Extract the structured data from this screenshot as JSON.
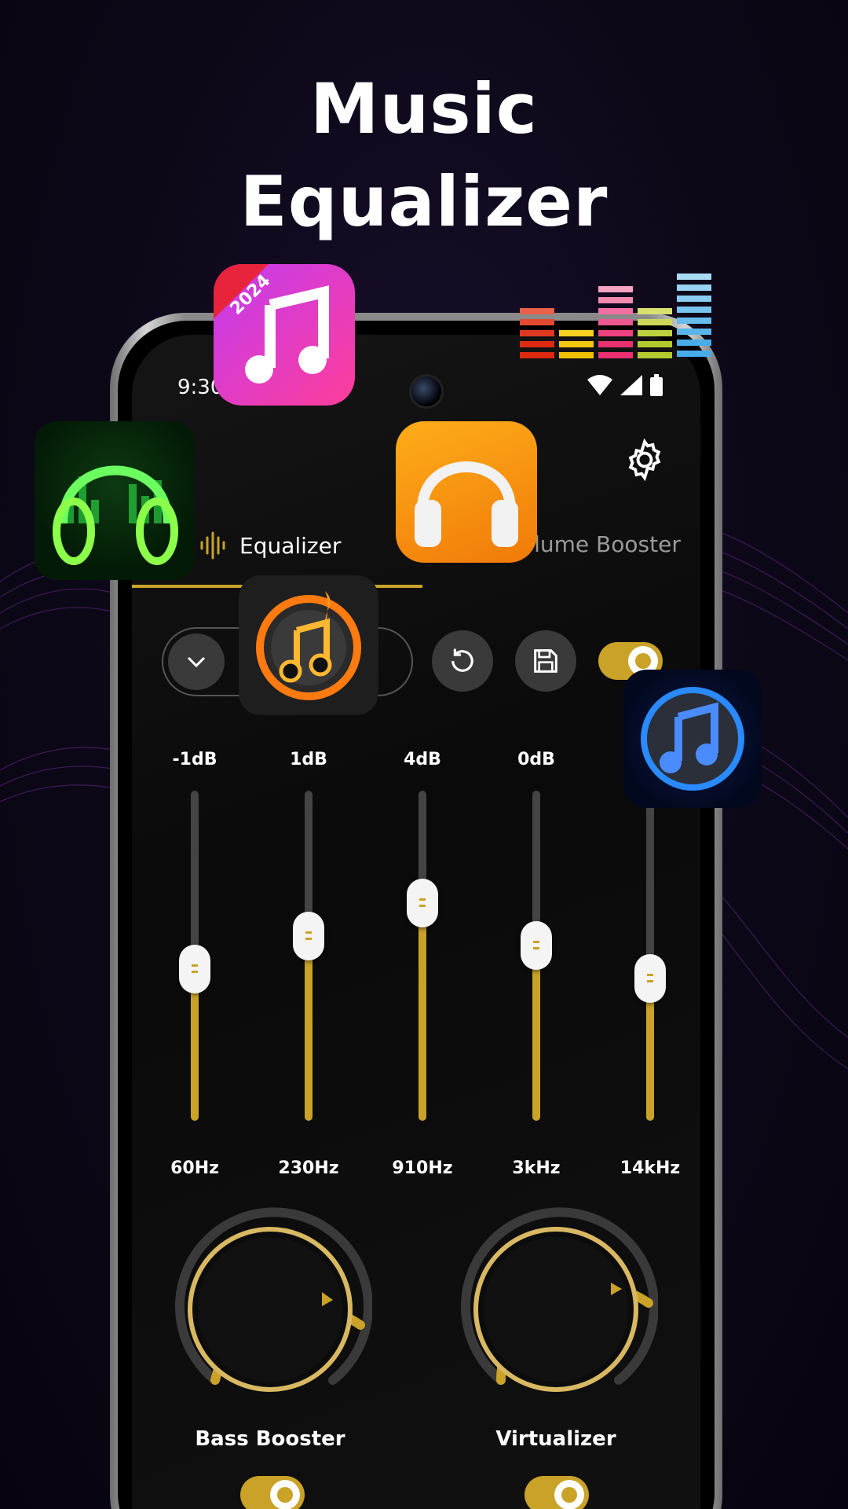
{
  "headline": {
    "line1": "Music",
    "line2": "Equalizer"
  },
  "status": {
    "time": "9:30"
  },
  "tabs": {
    "equalizer": "Equalizer",
    "volume_booster": "olume Booster"
  },
  "bands": [
    {
      "db": "-1dB",
      "freq": "60Hz",
      "level": 0.46
    },
    {
      "db": "1dB",
      "freq": "230Hz",
      "level": 0.56
    },
    {
      "db": "4dB",
      "freq": "910Hz",
      "level": 0.66
    },
    {
      "db": "0dB",
      "freq": "3kHz",
      "level": 0.53
    },
    {
      "db": "",
      "freq": "14kHz",
      "level": 0.43
    }
  ],
  "knobs": {
    "bass": "Bass Booster",
    "virtualizer": "Virtualizer"
  },
  "icons": {
    "app_badge": "2024",
    "accent": "#c9a227",
    "names": [
      "music-note-app-icon",
      "equalizer-bars-icon",
      "neon-headphones-icon",
      "orange-headphones-icon",
      "fire-music-icon",
      "blue-music-icon"
    ]
  }
}
